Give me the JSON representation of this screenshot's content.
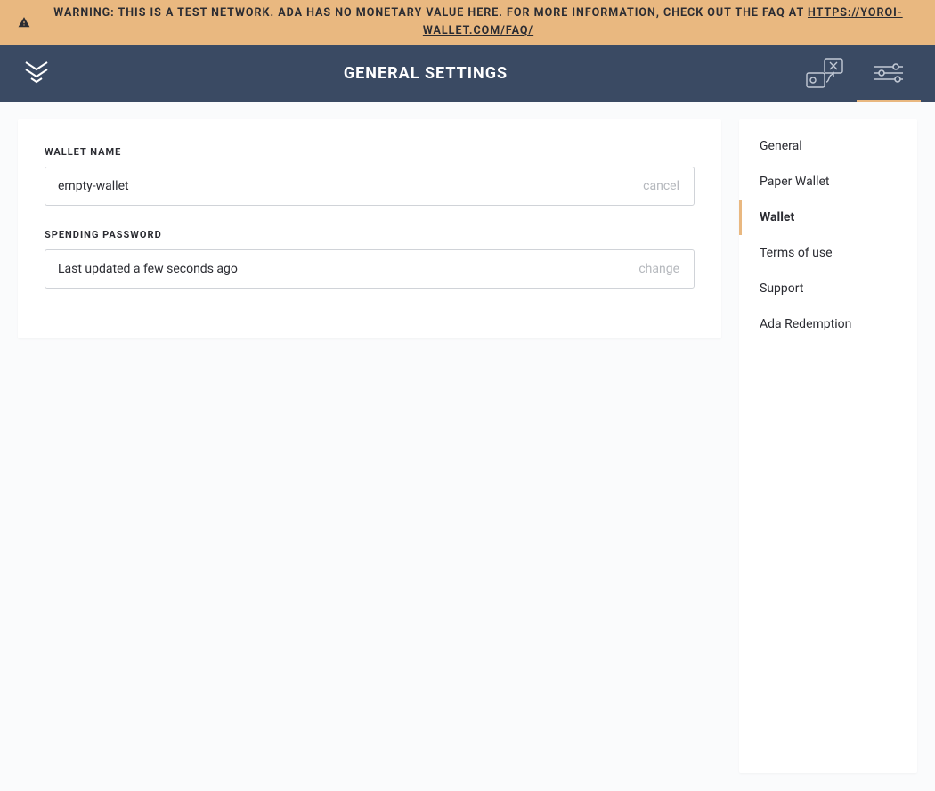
{
  "warning": {
    "prefix": "WARNING: THIS IS A TEST NETWORK. ADA HAS NO MONETARY VALUE HERE. FOR MORE INFORMATION, CHECK OUT THE FAQ AT ",
    "link_text": "HTTPS://YOROI-WALLET.COM/FAQ/"
  },
  "header": {
    "title": "GENERAL SETTINGS"
  },
  "fields": {
    "walletName": {
      "label": "WALLET NAME",
      "value": "empty-wallet",
      "action": "cancel"
    },
    "spendingPassword": {
      "label": "SPENDING PASSWORD",
      "static": "Last updated a few seconds ago",
      "action": "change"
    }
  },
  "sidebar": {
    "items": [
      {
        "label": "General",
        "active": false
      },
      {
        "label": "Paper Wallet",
        "active": false
      },
      {
        "label": "Wallet",
        "active": true
      },
      {
        "label": "Terms of use",
        "active": false
      },
      {
        "label": "Support",
        "active": false
      },
      {
        "label": "Ada Redemption",
        "active": false
      }
    ]
  }
}
